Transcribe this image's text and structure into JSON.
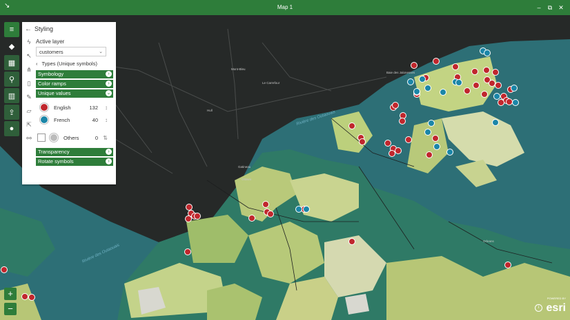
{
  "window": {
    "title": "Map 1",
    "back_glyph": "↘",
    "minimize_glyph": "–",
    "restore_glyph": "⧉",
    "close_glyph": "✕"
  },
  "rail": {
    "icons": [
      "menu-icon",
      "layers-icon",
      "basemap-icon",
      "search-icon",
      "chart-icon",
      "share-icon",
      "profile-icon"
    ]
  },
  "panel": {
    "title": "Styling",
    "active_layer_label": "Active layer",
    "layer_value": "customers",
    "types_label": "Types (Unique symbols)",
    "symbology": "Symbology",
    "color_ramps": "Color ramps",
    "unique_values": "Unique values",
    "values": [
      {
        "label": "English",
        "count": "132",
        "color": "#c0272d"
      },
      {
        "label": "French",
        "count": "40",
        "color": "#1b86a8"
      }
    ],
    "others_label": "Others",
    "others_count": "0",
    "transparency": "Transparency",
    "rotate_symbols": "Rotate symbols"
  },
  "zoom": {
    "in": "+",
    "out": "−"
  },
  "attribution": {
    "powered_by": "POWERED BY",
    "brand": "esri"
  },
  "map_labels": {
    "places": [
      "Gatineau",
      "Ottawa",
      "Mont-Bleu",
      "Le Carrefour",
      "Baie des Jalonesses",
      "Orleans",
      "Hull",
      "Aylmer"
    ],
    "rivers": [
      "Rivière des Outaouais",
      "Rivière des Outaouais"
    ]
  },
  "colors": {
    "accent": "#2e7d3a",
    "english": "#c0272d",
    "french": "#1b86a8",
    "water": "#2d6f76",
    "land_dark": "#2b2d2c"
  }
}
